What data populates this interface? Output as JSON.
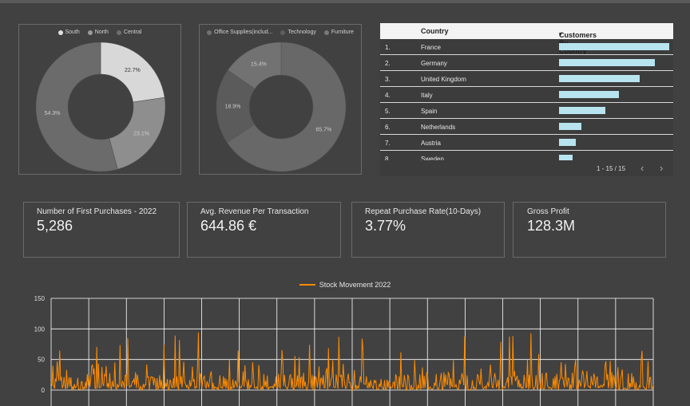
{
  "colors": {
    "background": "#414141",
    "accent_orange": "#ff8c00",
    "bar_blue": "#b7e4ef"
  },
  "region_pie": {
    "legend": [
      {
        "label": "South",
        "color": "#e0e0e0"
      },
      {
        "label": "North",
        "color": "#9a9a9a"
      },
      {
        "label": "Central",
        "color": "#6e6e6e"
      }
    ],
    "slices": [
      {
        "label": "South",
        "value": 22.7,
        "text": "22.7%",
        "color": "#d8d8d8"
      },
      {
        "label": "North",
        "value": 23.1,
        "text": "23.1%",
        "color": "#8e8e8e"
      },
      {
        "label": "Central",
        "value": 54.3,
        "text": "54.3%",
        "color": "#6b6b6b"
      }
    ]
  },
  "category_pie": {
    "legend": [
      {
        "label": "Office Supplies(includ...",
        "color": "#707070"
      },
      {
        "label": "Technology",
        "color": "#5e5e5e"
      },
      {
        "label": "Furniture",
        "color": "#787878"
      }
    ],
    "slices": [
      {
        "label": "Furniture",
        "value": 65.7,
        "text": "65.7%",
        "color": "#686868"
      },
      {
        "label": "Technology",
        "value": 18.9,
        "text": "18.9%",
        "color": "#5b5b5b"
      },
      {
        "label": "Office Supplies",
        "value": 15.4,
        "text": "15.4%",
        "color": "#727272"
      }
    ]
  },
  "country_table": {
    "col_country": "Country",
    "col_customers": "Customers By Country",
    "sort_icon": "▾",
    "rows": [
      {
        "idx": "1.",
        "country": "France",
        "value": 1.0
      },
      {
        "idx": "2.",
        "country": "Germany",
        "value": 0.87
      },
      {
        "idx": "3.",
        "country": "United Kingdom",
        "value": 0.73
      },
      {
        "idx": "4.",
        "country": "Italy",
        "value": 0.54
      },
      {
        "idx": "5.",
        "country": "Spain",
        "value": 0.42
      },
      {
        "idx": "6.",
        "country": "Netherlands",
        "value": 0.2
      },
      {
        "idx": "7.",
        "country": "Austria",
        "value": 0.15
      },
      {
        "idx": "8.",
        "country": "Sweden",
        "value": 0.12
      }
    ],
    "pager_text": "1 - 15 / 15",
    "prev_icon": "‹",
    "next_icon": "›"
  },
  "kpis": [
    {
      "label": "Number of First Purchases - 2022",
      "value": "5,286"
    },
    {
      "label": "Avg. Revenue Per Transaction",
      "value": "644.86 €"
    },
    {
      "label": "Repeat Purchase Rate(10-Days)",
      "value": "3.77%"
    },
    {
      "label": "Gross Profit",
      "value": "128.3M"
    }
  ],
  "chart_data": {
    "type": "line",
    "series": [
      {
        "name": "Stock Movement 2022"
      }
    ],
    "ylim": [
      0,
      150
    ],
    "yticks": [
      0,
      50,
      100,
      150
    ],
    "x_gridlines": 16,
    "grid": true,
    "legend": "top-center",
    "points_note": "dense daily noise, mostly 0-40, spikes up to ~97"
  }
}
